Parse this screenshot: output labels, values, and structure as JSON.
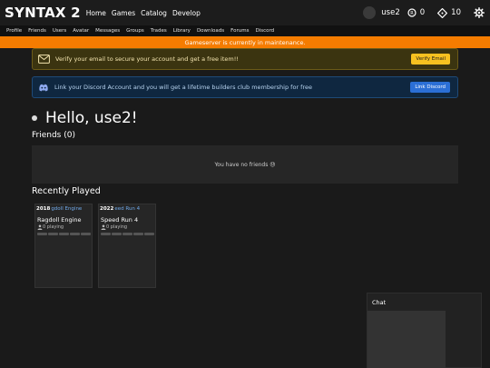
{
  "header": {
    "logo": "SYNTAX 2",
    "nav": [
      "Home",
      "Games",
      "Catalog",
      "Develop"
    ],
    "username": "use2",
    "robux": "0",
    "tickets": "10"
  },
  "subnav": [
    "Profile",
    "Friends",
    "Users",
    "Avatar",
    "Messages",
    "Groups",
    "Trades",
    "Library",
    "Downloads",
    "Forums",
    "Discord"
  ],
  "maintenance": "Gameserver is currently in maintenance.",
  "alerts": {
    "email_text": "Verify your email to secure your account and get a free item!!",
    "email_button": "Verify Email",
    "discord_text": "Link your Discord Account and you will get a lifetime builders club membership for free",
    "discord_button": "Link Discord"
  },
  "greeting": "Hello, use2!",
  "friends": {
    "title": "Friends (0)",
    "empty": "You have no friends 😓"
  },
  "recent": {
    "title": "Recently Played",
    "games": [
      {
        "year": "2018",
        "thumb_name": "gdoll Engine",
        "name": "Ragdoll Engine",
        "playing": "0 playing"
      },
      {
        "year": "2022",
        "thumb_name": "eed Run 4",
        "name": "Speed Run 4",
        "playing": "0 playing"
      }
    ]
  },
  "chat": {
    "title": "Chat"
  },
  "colors": {
    "maintenance": "#f57c00",
    "verify_button": "#f7c120",
    "discord_button": "#2b6fd6"
  }
}
